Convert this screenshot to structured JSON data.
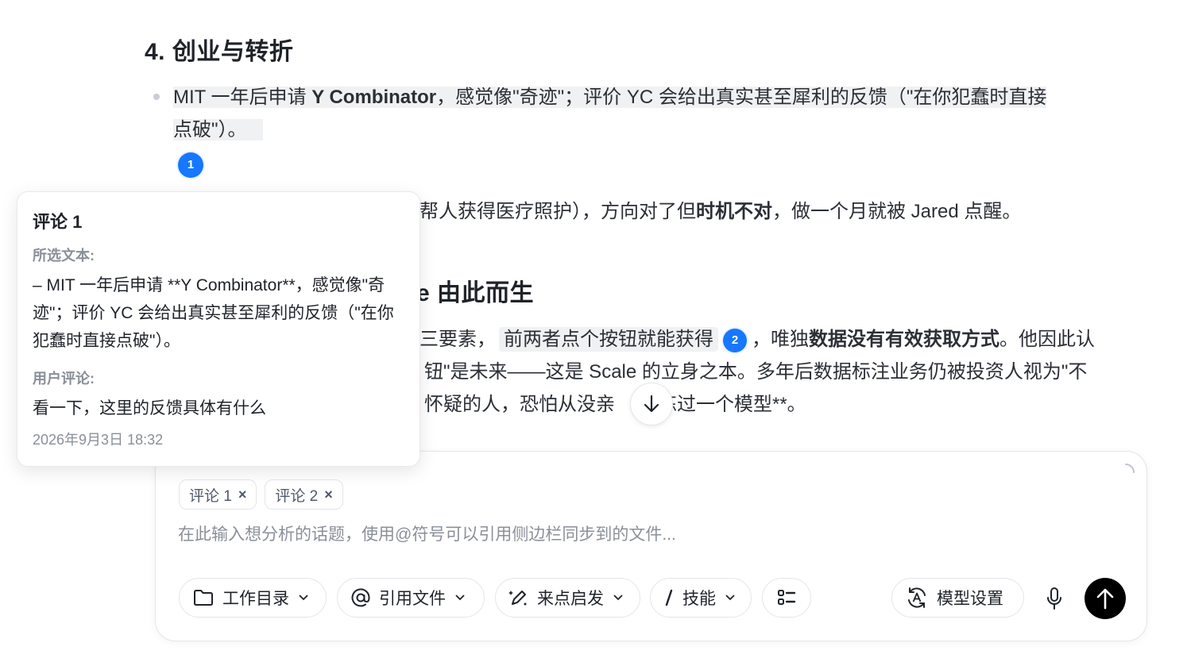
{
  "document": {
    "heading4": "4. 创业与转折",
    "bullet1_prefix": "MIT 一年后申请 ",
    "bullet1_bold": "Y Combinator",
    "bullet1_suffix": "，感觉像\"奇迹\"；评价 YC 会给出真实甚至犀利的反馈（\"在你犯蠢时直接",
    "bullet1_line2": "点破\"）。",
    "marker1": "1",
    "bullet2_visible_prefix": "帮人获得医疗照护），方向对了但",
    "bullet2_bold": "时机不对",
    "bullet2_suffix": "，做一个月就被 Jared 点醒。",
    "heading5_visible": "e 由此而生",
    "para_line1_prefix": "三要素，",
    "para_line1_highlight": "前两者点个按钮就能获得",
    "marker2": "2",
    "para_line1_mid": "，唯独",
    "para_line1_bold": "数据没有有效获取方式",
    "para_line1_suffix": "。他因此认",
    "para_line2": "钮\"是未来——这是 Scale 的立身之本。多年后数据标注业务仍被投资人视为\"不",
    "para_line3_prefix": "怀疑的人，恐怕从没亲",
    "para_line3_suffix": "练过一个模型**。"
  },
  "comment_popover": {
    "title": "评论 1",
    "selected_label": "所选文本:",
    "selected_text": "– MIT 一年后申请 **Y Combinator**，感觉像\"奇迹\"；评价 YC 会给出真实甚至犀利的反馈（\"在你犯蠢时直接点破\"）。",
    "user_comment_label": "用户评论:",
    "user_comment": "看一下，这里的反馈具体有什么",
    "timestamp": "2026年9月3日 18:32"
  },
  "composer": {
    "chips": [
      {
        "label": "评论 1"
      },
      {
        "label": "评论 2"
      }
    ],
    "chip_remove": "×",
    "placeholder": "在此输入想分析的话题，使用@符号可以引用侧边栏同步到的文件...",
    "tools": {
      "workdir": "工作目录",
      "cite_file": "引用文件",
      "inspiration": "来点启发",
      "skills": "技能",
      "model_settings": "模型设置"
    },
    "icons": {
      "workdir": "folder-icon",
      "cite_file": "at-sign-icon",
      "inspiration": "magic-pen-icon",
      "skills": "slash-icon",
      "layout": "list-layout-icon",
      "model": "model-translate-icon",
      "mic": "microphone-icon",
      "send": "arrow-up-icon",
      "scroll": "arrow-down-icon"
    }
  },
  "colors": {
    "accent_blue": "#1677ff",
    "send_button": "#000000",
    "highlight_bg": "#f0f1f3",
    "muted_text": "#8a8f99"
  }
}
